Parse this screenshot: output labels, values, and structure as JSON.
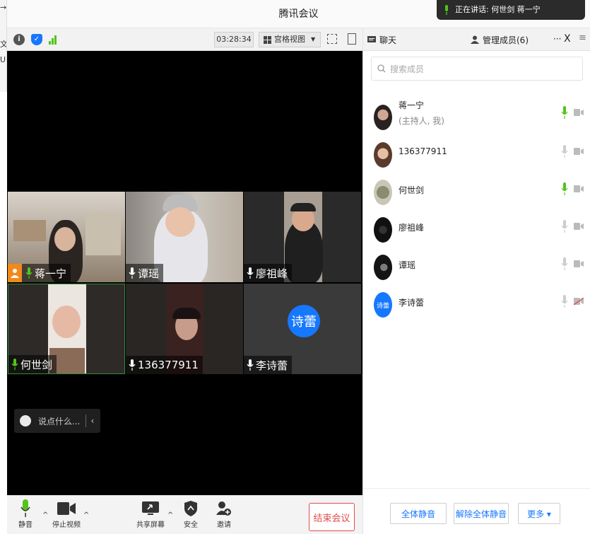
{
  "sliver": {
    "chars": [
      "→",
      "文",
      "U"
    ]
  },
  "window": {
    "title": "腾讯会议"
  },
  "speaking": {
    "label": "正在讲话: 何世剑 蒋一宁"
  },
  "video_toolbar": {
    "timer": "03:28:34",
    "view_mode": "宫格视图",
    "icons": [
      "info-icon",
      "shield-icon",
      "signal-icon",
      "fullscreen-icon",
      "sidebar-toggle-icon"
    ]
  },
  "tiles": [
    {
      "name": "蒋一宁",
      "host": true,
      "mic_color": "#52c41a"
    },
    {
      "name": "谭瑶",
      "host": false,
      "mic_color": "#ffffff"
    },
    {
      "name": "廖祖峰",
      "host": false,
      "mic_color": "#ffffff"
    },
    {
      "name": "何世剑",
      "host": false,
      "mic_color": "#52c41a",
      "active": true
    },
    {
      "name": "136377911",
      "host": false,
      "mic_color": "#ffffff"
    },
    {
      "name": "李诗蕾",
      "host": false,
      "mic_color": "#ffffff",
      "avatar_text": "诗蕾"
    }
  ],
  "chat": {
    "placeholder": "说点什么..."
  },
  "bottom_toolbar": {
    "mute": "静音",
    "stop_video": "停止视频",
    "share_screen": "共享屏幕",
    "security": "安全",
    "invite": "邀请",
    "end_meeting": "结束会议"
  },
  "panel": {
    "tab_chat": "聊天",
    "tab_members": "管理成员(6)",
    "more": "···",
    "close": "X",
    "menu": "≡",
    "search_placeholder": "搜索成员",
    "members": [
      {
        "name": "蒋一宁",
        "sub": "(主持人, 我)",
        "mic": "#52c41a",
        "cam_muted": false
      },
      {
        "name": "136377911",
        "sub": "",
        "mic": "#cccccc",
        "cam_muted": false
      },
      {
        "name": "何世剑",
        "sub": "",
        "mic": "#52c41a",
        "cam_muted": false
      },
      {
        "name": "廖祖峰",
        "sub": "",
        "mic": "#cccccc",
        "cam_muted": false
      },
      {
        "name": "谭瑶",
        "sub": "",
        "mic": "#cccccc",
        "cam_muted": false
      },
      {
        "name": "李诗蕾",
        "sub": "",
        "mic": "#cccccc",
        "cam_muted": true,
        "avatar_text": "诗蕾"
      }
    ],
    "footer": {
      "mute_all": "全体静音",
      "unmute_all": "解除全体静音",
      "more": "更多 ▾"
    }
  },
  "colors": {
    "accent": "#1677ff",
    "end": "#e24b4b",
    "host_tag": "#f08a1c",
    "active_border": "#2f8f3a"
  }
}
